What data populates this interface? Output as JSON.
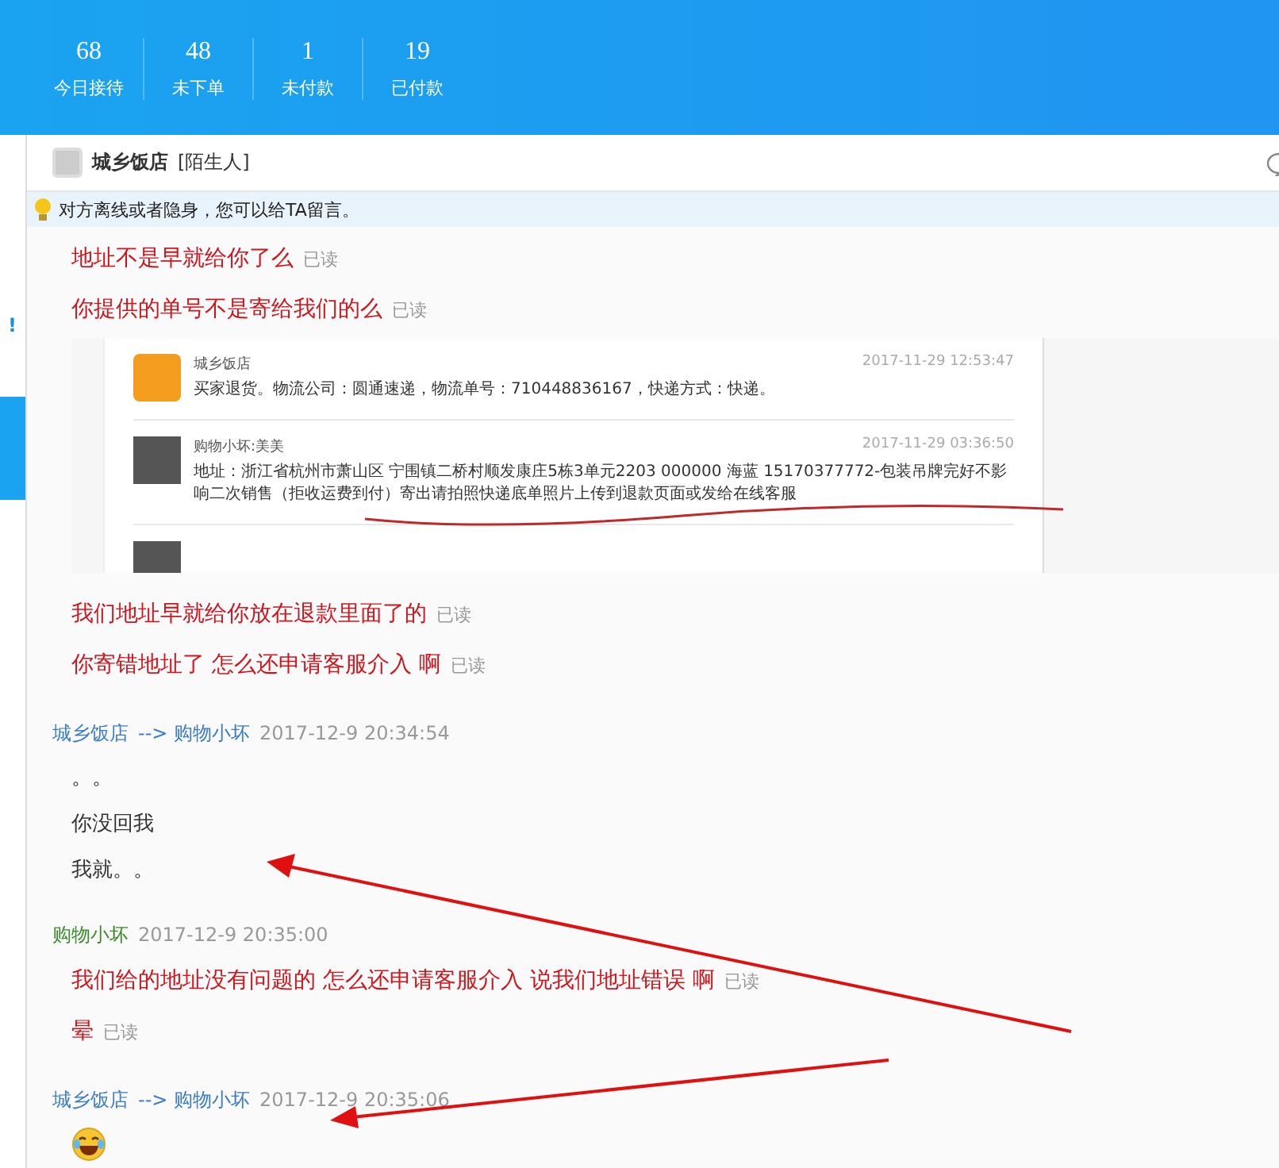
{
  "header": {
    "stats": [
      {
        "value": "68",
        "label": "今日接待"
      },
      {
        "value": "48",
        "label": "未下单"
      },
      {
        "value": "1",
        "label": "未付款"
      },
      {
        "value": "19",
        "label": "已付款"
      }
    ]
  },
  "sidebar": {
    "mark": "!"
  },
  "contact": {
    "name": "城乡饭店",
    "tag": "[陌生人]"
  },
  "notice": "对方离线或者隐身，您可以给TA留言。",
  "messages": [
    {
      "kind": "sent",
      "text": "地址不是早就给你了么",
      "status": "已读"
    },
    {
      "kind": "sent",
      "text": "你提供的单号不是寄给我们的么",
      "status": "已读"
    },
    {
      "kind": "image",
      "records": [
        {
          "kind": "cartoon",
          "name": "城乡饭店",
          "time": "2017-11-29 12:53:47",
          "text": "买家退货。物流公司：圆通速递，物流单号：710448836167，快递方式：快递。"
        },
        {
          "kind": "photo",
          "name": "购物小坏:美美",
          "time": "2017-11-29 03:36:50",
          "text": "地址：浙江省杭州市萧山区 宁围镇二桥村顺发康庄5栋3单元2203 000000 海蓝 15170377772-包装吊牌完好不影响二次销售（拒收运费到付）寄出请拍照快递底单照片上传到退款页面或发给在线客服"
        }
      ]
    },
    {
      "kind": "sent",
      "text": "我们地址早就给你放在退款里面了的",
      "status": "已读"
    },
    {
      "kind": "sent",
      "text": "你寄错地址了 怎么还申请客服介入 啊",
      "status": "已读"
    },
    {
      "kind": "header",
      "from": "城乡饭店",
      "to": "--> 购物小坏",
      "time": "2017-12-9 20:34:54",
      "color": "#3a7bc8"
    },
    {
      "kind": "text",
      "text": "。。"
    },
    {
      "kind": "text",
      "text": "你没回我"
    },
    {
      "kind": "text",
      "text": "我就。。"
    },
    {
      "kind": "header",
      "from": "购物小坏",
      "time": "2017-12-9 20:35:00",
      "color": "#3d8a2e"
    },
    {
      "kind": "sent",
      "text": "我们给的地址没有问题的  怎么还申请客服介入 说我们地址错误 啊",
      "status": "已读"
    },
    {
      "kind": "sent",
      "text": "晕",
      "status": "已读"
    },
    {
      "kind": "header",
      "from": "城乡饭店",
      "to": "--> 购物小坏",
      "time": "2017-12-9 20:35:06",
      "color": "#3a7bc8"
    },
    {
      "kind": "emoji"
    }
  ]
}
